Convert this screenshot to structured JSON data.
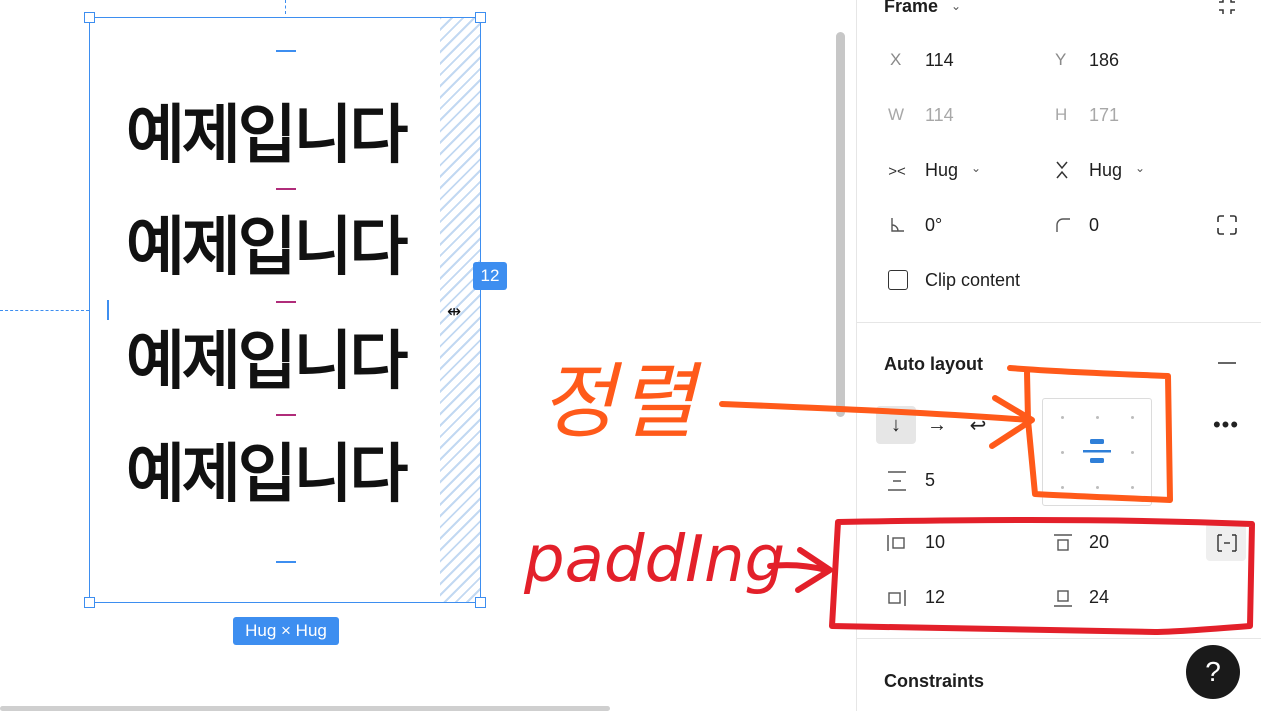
{
  "canvas": {
    "text_lines": [
      "예제입니다",
      "예제입니다",
      "예제입니다",
      "예제입니다"
    ],
    "gap_badge": "12",
    "size_badge": "Hug × Hug"
  },
  "annotations": {
    "align_text": "정렬",
    "padding_text": "paddIng"
  },
  "panel": {
    "frame": {
      "title": "Frame",
      "x_label": "X",
      "x_value": "114",
      "y_label": "Y",
      "y_value": "186",
      "w_label": "W",
      "w_value": "114",
      "h_label": "H",
      "h_value": "171",
      "width_mode": "Hug",
      "height_mode": "Hug",
      "rotation": "0°",
      "corner_radius": "0",
      "clip_content_label": "Clip content"
    },
    "auto_layout": {
      "title": "Auto layout",
      "spacing": "5",
      "padding_left": "10",
      "padding_top": "20",
      "padding_right": "12",
      "padding_bottom": "24"
    },
    "constraints": {
      "title": "Constraints"
    },
    "help_label": "?"
  },
  "colors": {
    "selection": "#3d8ef0",
    "annotation_orange": "#ff5a1a",
    "annotation_red": "#e3202a",
    "align_accent": "#2f7fd8"
  }
}
